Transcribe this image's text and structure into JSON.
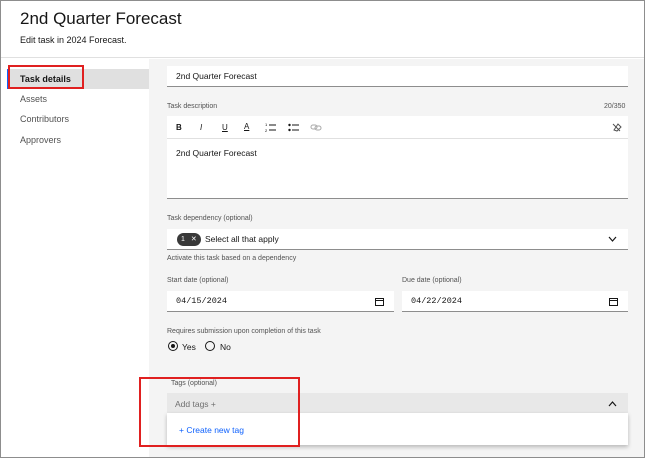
{
  "header": {
    "title": "2nd Quarter Forecast",
    "subtitle": "Edit task in 2024 Forecast."
  },
  "sidebar": {
    "items": [
      {
        "label": "Task details",
        "active": true
      },
      {
        "label": "Assets"
      },
      {
        "label": "Contributors"
      },
      {
        "label": "Approvers"
      }
    ]
  },
  "form": {
    "task_name_value": "2nd Quarter Forecast",
    "description_label": "Task description",
    "description_counter": "20/350",
    "toolbar": {
      "bold": "B",
      "italic": "I",
      "underline": "U",
      "color": "A"
    },
    "description_value": "2nd Quarter Forecast",
    "dependency_label": "Task dependency (optional)",
    "dependency_count": "1",
    "dependency_placeholder": "Select all that apply",
    "dependency_helper": "Activate this task based on a dependency",
    "start_label": "Start date (optional)",
    "start_value": "04/15/2024",
    "due_label": "Due date (optional)",
    "due_value": "04/22/2024",
    "submission_label": "Requires submission upon completion of this task",
    "yes_label": "Yes",
    "no_label": "No",
    "tags_label": "Tags (optional)",
    "tags_placeholder": "Add tags +",
    "create_tag_label": "+ Create new tag"
  },
  "colors": {
    "accent": "#0f62fe",
    "highlight_box": "#e02020"
  }
}
